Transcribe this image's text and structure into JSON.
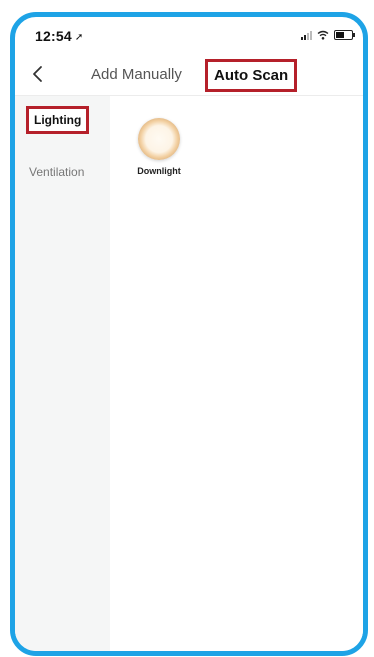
{
  "status_bar": {
    "time": "12:54",
    "location_icon": "location-arrow-icon",
    "signal_icon": "cellular-signal-icon",
    "wifi_icon": "wifi-icon",
    "battery_icon": "battery-icon"
  },
  "nav": {
    "back_icon": "chevron-left-icon",
    "tabs": [
      {
        "label": "Add Manually",
        "selected": false
      },
      {
        "label": "Auto Scan",
        "selected": true
      }
    ]
  },
  "sidebar": {
    "items": [
      {
        "label": "Lighting",
        "selected": true
      },
      {
        "label": "Ventilation",
        "selected": false
      }
    ]
  },
  "devices": [
    {
      "label": "Downlight",
      "icon": "downlight-icon"
    }
  ],
  "colors": {
    "frame_border": "#1ea3e6",
    "highlight_box": "#b5202a",
    "sidebar_bg": "#f5f6f6"
  }
}
